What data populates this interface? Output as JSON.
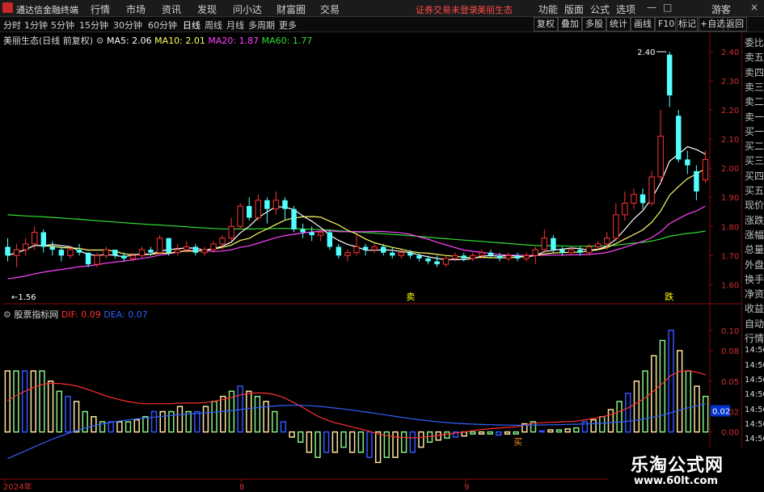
{
  "app": {
    "name": "通达信金融终端"
  },
  "menu": [
    "行情",
    "市场",
    "资讯",
    "发现",
    "问小达",
    "财富圈",
    "交易"
  ],
  "notice": [
    "证券交易未登录",
    "美丽生态"
  ],
  "menu_right": [
    "功能",
    "版面",
    "公式",
    "选项"
  ],
  "window_buttons": [
    "—",
    "□",
    "×"
  ],
  "periods": [
    "分时",
    "1分钟",
    "5分钟",
    "15分钟",
    "30分钟",
    "60分钟",
    "日线",
    "周线",
    "月线",
    "多周期",
    "更多"
  ],
  "toolbar_right": [
    "复权",
    "叠加",
    "多股",
    "统计",
    "画线",
    "F10",
    "标记",
    "+自选",
    "返回"
  ],
  "kline_info": {
    "title": "美丽生态(日线 前复权)",
    "ma5": "MA5: 2.06",
    "ma10": "MA10: 2.01",
    "ma20": "MA20: 1.87",
    "ma60": "MA60: 1.77"
  },
  "macd_info": {
    "title": "股票指标网",
    "dif": "DIF: 0.09",
    "dea": "DEA: 0.07"
  },
  "price_axis": [
    "2.40",
    "2.30",
    "2.20",
    "2.10",
    "2.00",
    "1.90",
    "1.80",
    "1.70",
    "1.60"
  ],
  "macd_axis": [
    "0.10",
    "0.08",
    "0.05",
    "0.02",
    "0.00"
  ],
  "macd_current": "0.02",
  "labels": {
    "high": "2.40",
    "low": "1.56",
    "signal_a": "卖",
    "signal_b": "跌",
    "signal_c": "买"
  },
  "date_axis": [
    "2024年",
    "8",
    "9"
  ],
  "right_panel": [
    "委比",
    "卖五",
    "卖四",
    "卖三",
    "卖二",
    "卖一",
    "买一",
    "买二",
    "买三",
    "买四",
    "买五",
    "现价",
    "涨跌",
    "涨幅",
    "总量",
    "外盘",
    "换手",
    "净资",
    "收益",
    "自动",
    "行情",
    "14:50",
    "14:50",
    "14:50",
    "14:50",
    "14:50",
    "14:50",
    "14:50"
  ],
  "watermark": {
    "title": "乐淘公式网",
    "url": "www.60lt.com"
  },
  "colors": {
    "up": "#ff3333",
    "down": "#54ffff",
    "ma5": "#ffffff",
    "ma10": "#ffff66",
    "ma20": "#ff44ff",
    "ma60": "#33dd33",
    "dif": "#ff3030",
    "dea": "#3060ff",
    "grid": "#8a0c0c"
  },
  "chart_data": {
    "type": "candlestick",
    "candles": [
      [
        1.73,
        1.7,
        1.76,
        1.68
      ],
      [
        1.7,
        1.72,
        1.74,
        1.66
      ],
      [
        1.72,
        1.74,
        1.76,
        1.7
      ],
      [
        1.74,
        1.78,
        1.8,
        1.72
      ],
      [
        1.78,
        1.73,
        1.79,
        1.71
      ],
      [
        1.73,
        1.72,
        1.75,
        1.7
      ],
      [
        1.72,
        1.7,
        1.73,
        1.68
      ],
      [
        1.7,
        1.72,
        1.73,
        1.69
      ],
      [
        1.72,
        1.71,
        1.74,
        1.7
      ],
      [
        1.71,
        1.67,
        1.71,
        1.66
      ],
      [
        1.67,
        1.7,
        1.71,
        1.66
      ],
      [
        1.7,
        1.72,
        1.73,
        1.69
      ],
      [
        1.72,
        1.7,
        1.72,
        1.69
      ],
      [
        1.7,
        1.69,
        1.71,
        1.68
      ],
      [
        1.69,
        1.7,
        1.71,
        1.68
      ],
      [
        1.7,
        1.72,
        1.73,
        1.69
      ],
      [
        1.72,
        1.71,
        1.73,
        1.7
      ],
      [
        1.71,
        1.76,
        1.77,
        1.7
      ],
      [
        1.76,
        1.71,
        1.76,
        1.7
      ],
      [
        1.71,
        1.72,
        1.74,
        1.7
      ],
      [
        1.72,
        1.73,
        1.75,
        1.71
      ],
      [
        1.73,
        1.71,
        1.74,
        1.7
      ],
      [
        1.71,
        1.72,
        1.73,
        1.7
      ],
      [
        1.72,
        1.74,
        1.75,
        1.71
      ],
      [
        1.74,
        1.76,
        1.77,
        1.72
      ],
      [
        1.76,
        1.8,
        1.83,
        1.75
      ],
      [
        1.8,
        1.87,
        1.88,
        1.79
      ],
      [
        1.87,
        1.83,
        1.9,
        1.82
      ],
      [
        1.83,
        1.89,
        1.91,
        1.82
      ],
      [
        1.89,
        1.86,
        1.9,
        1.81
      ],
      [
        1.86,
        1.89,
        1.92,
        1.84
      ],
      [
        1.89,
        1.86,
        1.9,
        1.82
      ],
      [
        1.86,
        1.79,
        1.87,
        1.78
      ],
      [
        1.79,
        1.78,
        1.81,
        1.76
      ],
      [
        1.78,
        1.77,
        1.8,
        1.75
      ],
      [
        1.77,
        1.78,
        1.79,
        1.75
      ],
      [
        1.78,
        1.73,
        1.79,
        1.72
      ],
      [
        1.73,
        1.7,
        1.74,
        1.69
      ],
      [
        1.7,
        1.71,
        1.72,
        1.68
      ],
      [
        1.71,
        1.73,
        1.77,
        1.7
      ],
      [
        1.73,
        1.72,
        1.74,
        1.7
      ],
      [
        1.72,
        1.73,
        1.74,
        1.71
      ],
      [
        1.73,
        1.71,
        1.74,
        1.7
      ],
      [
        1.71,
        1.7,
        1.73,
        1.69
      ],
      [
        1.7,
        1.71,
        1.72,
        1.69
      ],
      [
        1.71,
        1.7,
        1.72,
        1.69
      ],
      [
        1.7,
        1.69,
        1.71,
        1.68
      ],
      [
        1.69,
        1.68,
        1.7,
        1.67
      ],
      [
        1.68,
        1.67,
        1.7,
        1.66
      ],
      [
        1.67,
        1.69,
        1.7,
        1.66
      ],
      [
        1.69,
        1.7,
        1.71,
        1.68
      ],
      [
        1.7,
        1.69,
        1.71,
        1.68
      ],
      [
        1.69,
        1.7,
        1.71,
        1.68
      ],
      [
        1.7,
        1.71,
        1.72,
        1.69
      ],
      [
        1.71,
        1.7,
        1.72,
        1.69
      ],
      [
        1.7,
        1.69,
        1.71,
        1.68
      ],
      [
        1.69,
        1.7,
        1.71,
        1.68
      ],
      [
        1.7,
        1.69,
        1.71,
        1.68
      ],
      [
        1.69,
        1.7,
        1.71,
        1.68
      ],
      [
        1.7,
        1.72,
        1.73,
        1.67
      ],
      [
        1.72,
        1.76,
        1.79,
        1.71
      ],
      [
        1.76,
        1.72,
        1.77,
        1.71
      ],
      [
        1.72,
        1.71,
        1.73,
        1.7
      ],
      [
        1.71,
        1.72,
        1.73,
        1.7
      ],
      [
        1.72,
        1.71,
        1.73,
        1.7
      ],
      [
        1.71,
        1.73,
        1.74,
        1.7
      ],
      [
        1.73,
        1.74,
        1.75,
        1.72
      ],
      [
        1.74,
        1.76,
        1.78,
        1.72
      ],
      [
        1.76,
        1.84,
        1.88,
        1.75
      ],
      [
        1.84,
        1.88,
        1.92,
        1.82
      ],
      [
        1.88,
        1.91,
        1.93,
        1.86
      ],
      [
        1.91,
        1.88,
        1.93,
        1.86
      ],
      [
        1.88,
        1.97,
        1.99,
        1.87
      ],
      [
        1.97,
        2.11,
        2.2,
        1.95
      ],
      [
        2.39,
        2.25,
        2.4,
        2.21
      ],
      [
        2.18,
        2.03,
        2.2,
        2.02
      ],
      [
        2.03,
        2.01,
        2.06,
        1.98
      ],
      [
        1.99,
        1.92,
        2.01,
        1.89
      ],
      [
        1.96,
        2.03,
        2.06,
        1.95
      ]
    ],
    "macd_hist": [
      0.06,
      0.06,
      0.06,
      0.06,
      0.06,
      0.05,
      0.04,
      0.035,
      0.03,
      0.02,
      0.015,
      0.01,
      0.01,
      0.01,
      0.01,
      0.012,
      0.015,
      0.02,
      0.02,
      0.02,
      0.025,
      0.02,
      0.02,
      0.025,
      0.03,
      0.035,
      0.04,
      0.045,
      0.04,
      0.035,
      0.03,
      0.02,
      0.01,
      -0.005,
      -0.01,
      -0.02,
      -0.025,
      -0.02,
      -0.02,
      -0.015,
      -0.02,
      -0.02,
      -0.025,
      -0.03,
      -0.025,
      -0.025,
      -0.02,
      -0.02,
      -0.015,
      -0.01,
      -0.008,
      -0.006,
      -0.005,
      -0.004,
      -0.002,
      -0.002,
      -0.002,
      -0.003,
      -0.002,
      -0.002,
      0.008,
      0.01,
      0.001,
      0.002,
      0.002,
      0.003,
      0.004,
      0.01,
      0.012,
      0.015,
      0.022,
      0.03,
      0.038,
      0.05,
      0.06,
      0.075,
      0.09,
      0.1,
      0.08,
      0.06,
      0.045,
      0.035
    ],
    "price_range": [
      1.54,
      2.45
    ],
    "macd_range": [
      -0.04,
      0.115
    ]
  }
}
